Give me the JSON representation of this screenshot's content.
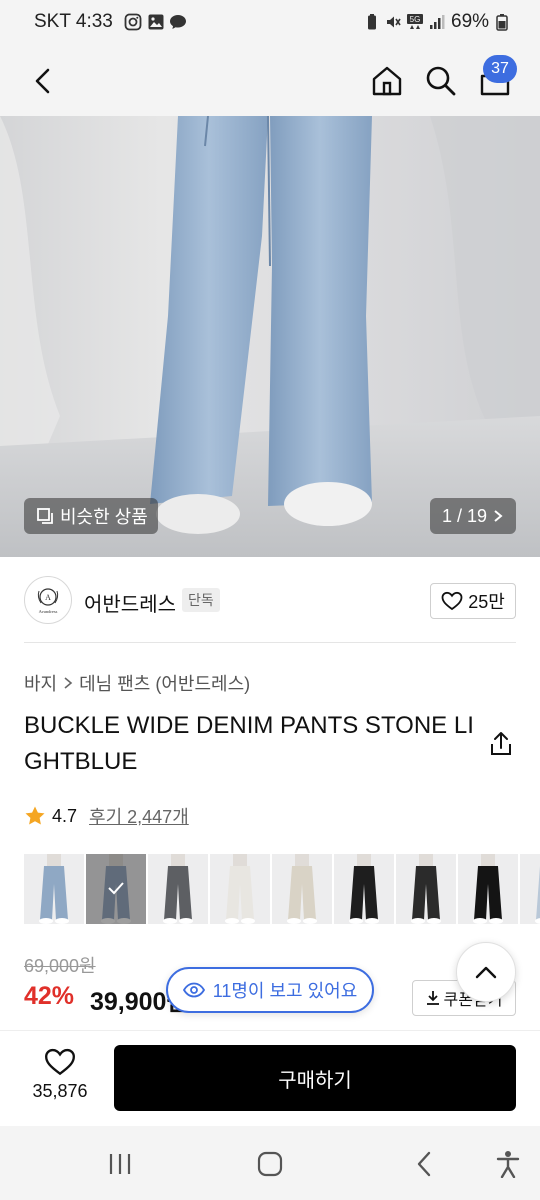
{
  "status_bar": {
    "carrier_time": "SKT 4:33",
    "battery": "69%"
  },
  "header": {
    "cart_count": "37"
  },
  "hero": {
    "similar_label": "비슷한 상품",
    "pager": "1 / 19"
  },
  "brand": {
    "name": "어반드레스",
    "exclusive_tag": "단독",
    "likes": "25만",
    "logo_text": "Avandress"
  },
  "breadcrumb": {
    "category": "바지",
    "subcategory": "데님 팬츠 (어반드레스)"
  },
  "product": {
    "title": "BUCKLE WIDE DENIM PANTS STONE LIGHTBLUE",
    "rating": "4.7",
    "reviews": "후기 2,447개",
    "original_price": "69,000원",
    "discount": "42%",
    "sale_price": "39,900원",
    "viewers": "11명이 보고 있어요",
    "coupon": "쿠폰받기"
  },
  "color_thumbs": [
    {
      "color": "#8fa8c4"
    },
    {
      "color": "#8ea3bd",
      "selected": true
    },
    {
      "color": "#5d5f63"
    },
    {
      "color": "#e8e6e1"
    },
    {
      "color": "#d9d3c6"
    },
    {
      "color": "#1e1e1e"
    },
    {
      "color": "#2b2b2b"
    },
    {
      "color": "#141414"
    },
    {
      "color": "#b9c8d8"
    }
  ],
  "purchase_bar": {
    "wish_count": "35,876",
    "buy_label": "구매하기"
  },
  "colors": {
    "accent_blue": "#3d6de0",
    "discount_red": "#e0302a",
    "star": "#f5a623"
  }
}
